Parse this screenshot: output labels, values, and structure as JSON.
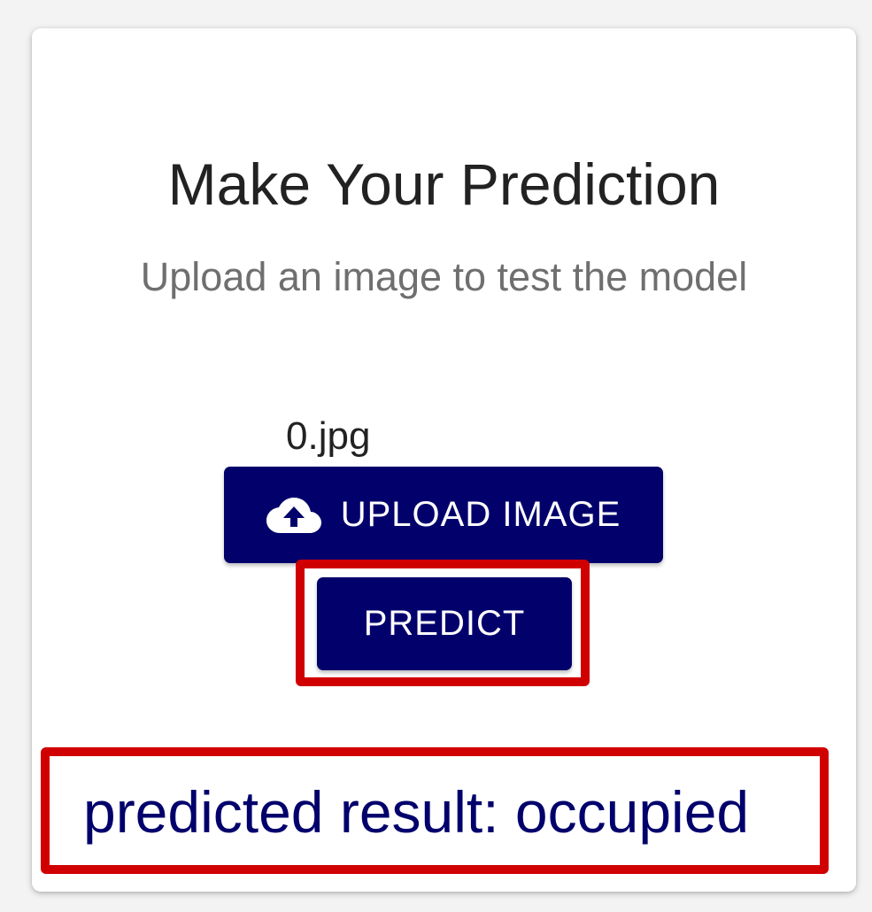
{
  "card": {
    "title": "Make Your Prediction",
    "subtitle": "Upload an image to test the model",
    "file_name": "0.jpg",
    "upload_button_label": "UPLOAD IMAGE",
    "upload_icon": "cloud-upload-icon",
    "predict_button_label": "PREDICT",
    "result_text": "predicted result: occupied"
  },
  "colors": {
    "button_bg": "#02016c",
    "result_text": "#02016c",
    "highlight_border": "#d00000"
  }
}
